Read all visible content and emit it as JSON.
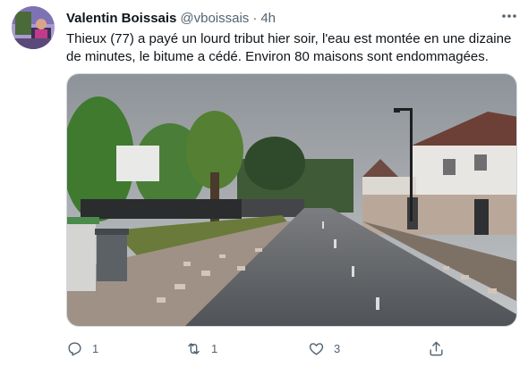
{
  "tweet": {
    "author": {
      "display_name": "Valentin Boissais",
      "handle": "@vboissais"
    },
    "separator": "·",
    "time": "4h",
    "text": "Thieux (77) a payé un lourd tribut hier soir, l'eau est montée en une dizaine de minutes, le bitume a cédé. Environ 80 maisons sont endommagées.",
    "actions": {
      "reply": {
        "icon": "reply-icon",
        "count": "1"
      },
      "retweet": {
        "icon": "retweet-icon",
        "count": "1"
      },
      "like": {
        "icon": "heart-icon",
        "count": "3"
      },
      "share": {
        "icon": "share-icon"
      }
    },
    "colors": {
      "text": "#0f1419",
      "secondary": "#536471",
      "border": "#cfd9de"
    }
  }
}
